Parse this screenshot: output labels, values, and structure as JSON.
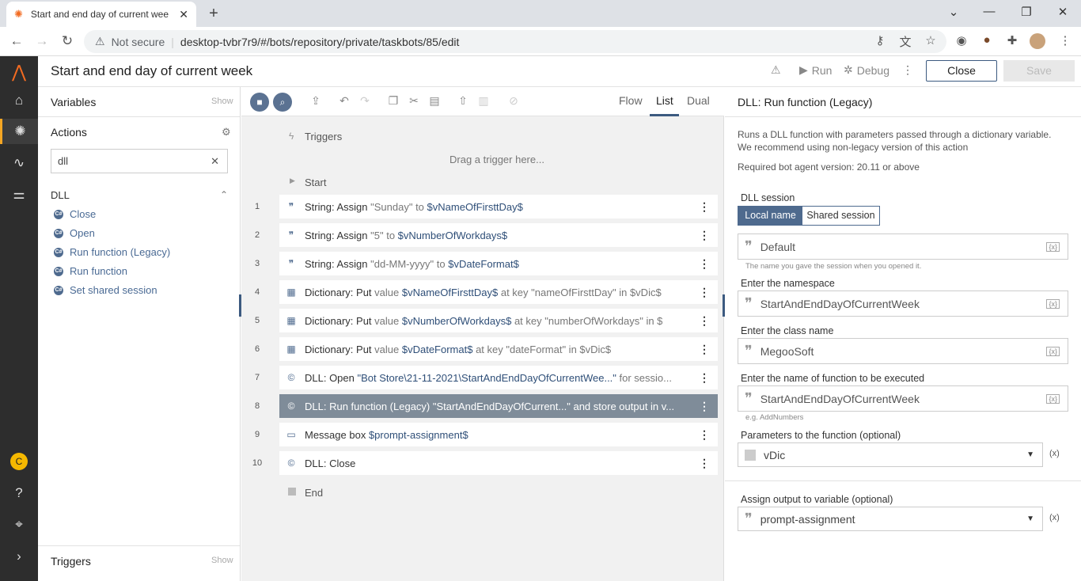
{
  "browser": {
    "tab_title": "Start and end day of current wee",
    "security": "Not secure",
    "url": "desktop-tvbr7r9/#/bots/repository/private/taskbots/85/edit"
  },
  "header": {
    "title": "Start and end day of current week",
    "run_label": "Run",
    "debug_label": "Debug",
    "close_label": "Close",
    "save_label": "Save"
  },
  "left": {
    "variables": "Variables",
    "actions": "Actions",
    "triggers": "Triggers",
    "show": "Show",
    "search_value": "dll",
    "group": "DLL",
    "items": [
      "Close",
      "Open",
      "Run function (Legacy)",
      "Run function",
      "Set shared session"
    ]
  },
  "nav": {
    "user_initial": "C"
  },
  "center": {
    "views": [
      "Flow",
      "List",
      "Dual"
    ],
    "triggers_label": "Triggers",
    "drag_hint": "Drag a trigger here...",
    "start_label": "Start",
    "end_label": "End",
    "rows": [
      {
        "n": "1",
        "a": "String: Assign",
        "b": "\"Sunday\"",
        "c": " to ",
        "d": "$vNameOfFirsttDay$"
      },
      {
        "n": "2",
        "a": "String: Assign",
        "b": "\"5\"",
        "c": " to ",
        "d": "$vNumberOfWorkdays$"
      },
      {
        "n": "3",
        "a": "String: Assign",
        "b": "\"dd-MM-yyyy\"",
        "c": " to ",
        "d": "$vDateFormat$"
      },
      {
        "n": "4",
        "a": "Dictionary: Put",
        "b": " value ",
        "c": "$vNameOfFirsttDay$",
        "d": " at key \"nameOfFirsttDay\" in $vDic$"
      },
      {
        "n": "5",
        "a": "Dictionary: Put",
        "b": " value ",
        "c": "$vNumberOfWorkdays$",
        "d": " at key \"numberOfWorkdays\" in $"
      },
      {
        "n": "6",
        "a": "Dictionary: Put",
        "b": " value ",
        "c": "$vDateFormat$",
        "d": " at key \"dateFormat\" in $vDic$"
      },
      {
        "n": "7",
        "a": "DLL: Open",
        "b": " \"Bot Store\\21-11-2021\\StartAndEndDayOfCurrentWee...\"",
        "c": " for sessio...",
        "d": ""
      },
      {
        "n": "8",
        "a": "DLL: Run function (Legacy)",
        "b": " \"StartAndEndDayOfCurrent...\"",
        "c": " and store output in v...",
        "d": ""
      },
      {
        "n": "9",
        "a": "Message box",
        "b": " $prompt-assignment$",
        "c": "",
        "d": ""
      },
      {
        "n": "10",
        "a": "DLL: Close",
        "b": "",
        "c": "",
        "d": ""
      }
    ]
  },
  "right": {
    "title": "DLL: Run function (Legacy)",
    "desc1": "Runs a DLL function with parameters passed through a dictionary variable.",
    "desc2": "We recommend using non-legacy version of this action",
    "required": "Required bot agent version: 20.11 or above",
    "session_label": "DLL session",
    "local_name": "Local name",
    "shared_session": "Shared session",
    "session_value": "Default",
    "session_hint": "The name you gave the session when you opened it.",
    "ns_label": "Enter the namespace",
    "ns_value": "StartAndEndDayOfCurrentWeek",
    "class_label": "Enter the class name",
    "class_value": "MegooSoft",
    "func_label": "Enter the name of function to be executed",
    "func_value": "StartAndEndDayOfCurrentWeek",
    "func_hint": "e.g. AddNumbers",
    "params_label": "Parameters to the function (optional)",
    "params_value": "vDic",
    "out_label": "Assign output to variable (optional)",
    "out_value": "prompt-assignment",
    "fx": "(x)"
  }
}
